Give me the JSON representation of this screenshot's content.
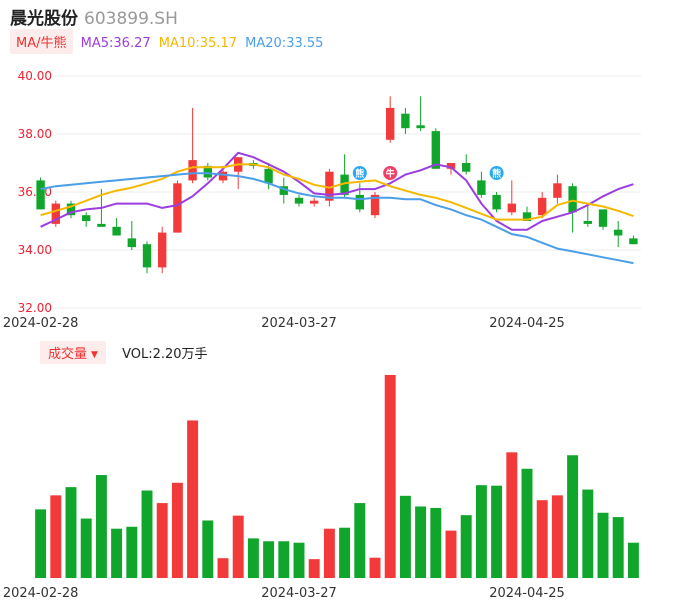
{
  "header": {
    "name": "晨光股份",
    "code": "603899.SH"
  },
  "legend": {
    "tag": "MA/牛熊",
    "ma5_label": "MA5:36.27",
    "ma10_label": "MA10:35.17",
    "ma20_label": "MA20:33.55"
  },
  "volume_header": {
    "tag": "成交量",
    "caret": "▼",
    "value_label": "VOL:2.20万手"
  },
  "colors": {
    "up": "#f23a3a",
    "down": "#10a52b",
    "ma5": "#9b3de0",
    "ma10": "#f4b800",
    "ma20": "#4a9ee8",
    "price_axis": "#e23"
  },
  "chart_data": [
    {
      "type": "candlestick",
      "y_ticks": [
        "40.00",
        "38.00",
        "36.00",
        "34.00",
        "32.00"
      ],
      "ylim": [
        32,
        40
      ],
      "x_tick_labels": [
        {
          "index": 0,
          "label": "2024-02-28"
        },
        {
          "index": 17,
          "label": "2024-03-27"
        },
        {
          "index": 32,
          "label": "2024-04-25"
        }
      ],
      "series": [
        {
          "name": "K",
          "ohlc": [
            [
              36.4,
              36.5,
              35.4,
              35.4
            ],
            [
              34.9,
              35.7,
              34.8,
              35.6
            ],
            [
              35.6,
              35.7,
              35.1,
              35.2
            ],
            [
              35.2,
              35.3,
              34.8,
              35.0
            ],
            [
              34.9,
              36.1,
              34.8,
              34.8
            ],
            [
              34.8,
              35.1,
              34.5,
              34.5
            ],
            [
              34.4,
              35.0,
              34.0,
              34.1
            ],
            [
              34.2,
              34.3,
              33.2,
              33.4
            ],
            [
              33.4,
              34.8,
              33.2,
              34.6
            ],
            [
              34.6,
              36.4,
              34.6,
              36.3
            ],
            [
              36.4,
              38.9,
              36.3,
              37.1
            ],
            [
              36.9,
              37.0,
              36.4,
              36.5
            ],
            [
              36.4,
              36.9,
              36.3,
              36.7
            ],
            [
              36.7,
              37.2,
              36.1,
              37.2
            ],
            [
              37.0,
              37.1,
              36.8,
              36.9
            ],
            [
              36.8,
              37.0,
              36.1,
              36.3
            ],
            [
              36.2,
              36.5,
              35.6,
              35.9
            ],
            [
              35.8,
              35.9,
              35.5,
              35.6
            ],
            [
              35.6,
              35.8,
              35.5,
              35.7
            ],
            [
              35.7,
              36.8,
              35.5,
              36.7
            ],
            [
              36.6,
              37.3,
              35.8,
              35.9
            ],
            [
              35.9,
              36.3,
              35.3,
              35.4
            ],
            [
              35.2,
              36.0,
              35.1,
              35.9
            ],
            [
              37.8,
              39.3,
              37.7,
              38.9
            ],
            [
              38.7,
              38.9,
              38.0,
              38.2
            ],
            [
              38.3,
              39.3,
              38.1,
              38.2
            ],
            [
              38.1,
              38.2,
              36.8,
              36.8
            ],
            [
              36.8,
              37.0,
              36.6,
              37.0
            ],
            [
              37.0,
              37.3,
              36.6,
              36.7
            ],
            [
              36.4,
              36.7,
              35.8,
              35.9
            ],
            [
              35.9,
              36.0,
              35.3,
              35.4
            ],
            [
              35.3,
              36.4,
              35.2,
              35.6
            ],
            [
              35.3,
              35.5,
              35.0,
              35.0
            ],
            [
              35.2,
              36.0,
              35.1,
              35.8
            ],
            [
              35.8,
              36.6,
              35.6,
              36.3
            ],
            [
              36.2,
              36.3,
              34.6,
              35.3
            ],
            [
              35.0,
              35.6,
              34.8,
              34.9
            ],
            [
              35.4,
              35.4,
              34.7,
              34.8
            ],
            [
              34.7,
              35.0,
              34.1,
              34.5
            ],
            [
              34.4,
              34.5,
              34.2,
              34.2
            ]
          ]
        },
        {
          "name": "MA5",
          "values": [
            34.8,
            35.05,
            35.3,
            35.4,
            35.45,
            35.6,
            35.6,
            35.6,
            35.45,
            35.55,
            35.85,
            36.3,
            36.8,
            37.35,
            37.2,
            36.95,
            36.7,
            36.35,
            35.95,
            35.9,
            35.95,
            36.1,
            36.1,
            36.3,
            36.6,
            36.75,
            36.95,
            36.85,
            36.4,
            35.6,
            35.0,
            34.7,
            34.7,
            35.0,
            35.15,
            35.3,
            35.55,
            35.85,
            36.1,
            36.27
          ]
        },
        {
          "name": "MA10",
          "values": [
            35.2,
            35.35,
            35.5,
            35.7,
            35.9,
            36.05,
            36.15,
            36.3,
            36.45,
            36.7,
            36.85,
            36.85,
            36.85,
            36.95,
            36.95,
            36.85,
            36.6,
            36.45,
            36.25,
            36.15,
            36.3,
            36.35,
            36.4,
            36.2,
            36.05,
            35.9,
            35.8,
            35.65,
            35.45,
            35.25,
            35.05,
            35.05,
            35.05,
            35.15,
            35.55,
            35.7,
            35.6,
            35.5,
            35.35,
            35.17
          ]
        },
        {
          "name": "MA20",
          "values": [
            36.1,
            36.2,
            36.25,
            36.3,
            36.35,
            36.4,
            36.45,
            36.5,
            36.55,
            36.6,
            36.65,
            36.65,
            36.6,
            36.55,
            36.45,
            36.3,
            36.1,
            35.95,
            35.85,
            35.8,
            35.8,
            35.75,
            35.8,
            35.8,
            35.75,
            35.75,
            35.55,
            35.4,
            35.2,
            35.05,
            34.8,
            34.55,
            34.45,
            34.25,
            34.05,
            33.95,
            33.85,
            33.75,
            33.65,
            33.55
          ]
        }
      ],
      "markers": [
        {
          "index": 21,
          "label": "熊",
          "color": "#29a9f0"
        },
        {
          "index": 23,
          "label": "牛",
          "color": "#f0406a"
        },
        {
          "index": 30,
          "label": "熊",
          "color": "#29a9f0"
        }
      ]
    },
    {
      "type": "bar",
      "name": "成交量",
      "values": [
        1.42,
        1.71,
        1.88,
        1.23,
        2.13,
        1.02,
        1.06,
        1.81,
        1.55,
        1.97,
        3.26,
        1.19,
        0.41,
        1.29,
        0.82,
        0.76,
        0.76,
        0.73,
        0.39,
        1.02,
        1.04,
        1.55,
        0.42,
        4.2,
        1.7,
        1.48,
        1.45,
        0.98,
        1.3,
        1.92,
        1.91,
        2.6,
        2.26,
        1.61,
        1.71,
        2.54,
        1.83,
        1.35,
        1.26,
        0.73
      ],
      "direction": [
        "down",
        "up",
        "down",
        "down",
        "down",
        "down",
        "down",
        "down",
        "up",
        "up",
        "up",
        "down",
        "up",
        "up",
        "down",
        "down",
        "down",
        "down",
        "up",
        "up",
        "down",
        "down",
        "up",
        "up",
        "down",
        "down",
        "down",
        "up",
        "down",
        "down",
        "down",
        "up",
        "down",
        "up",
        "up",
        "down",
        "down",
        "down",
        "down",
        "down"
      ]
    }
  ]
}
